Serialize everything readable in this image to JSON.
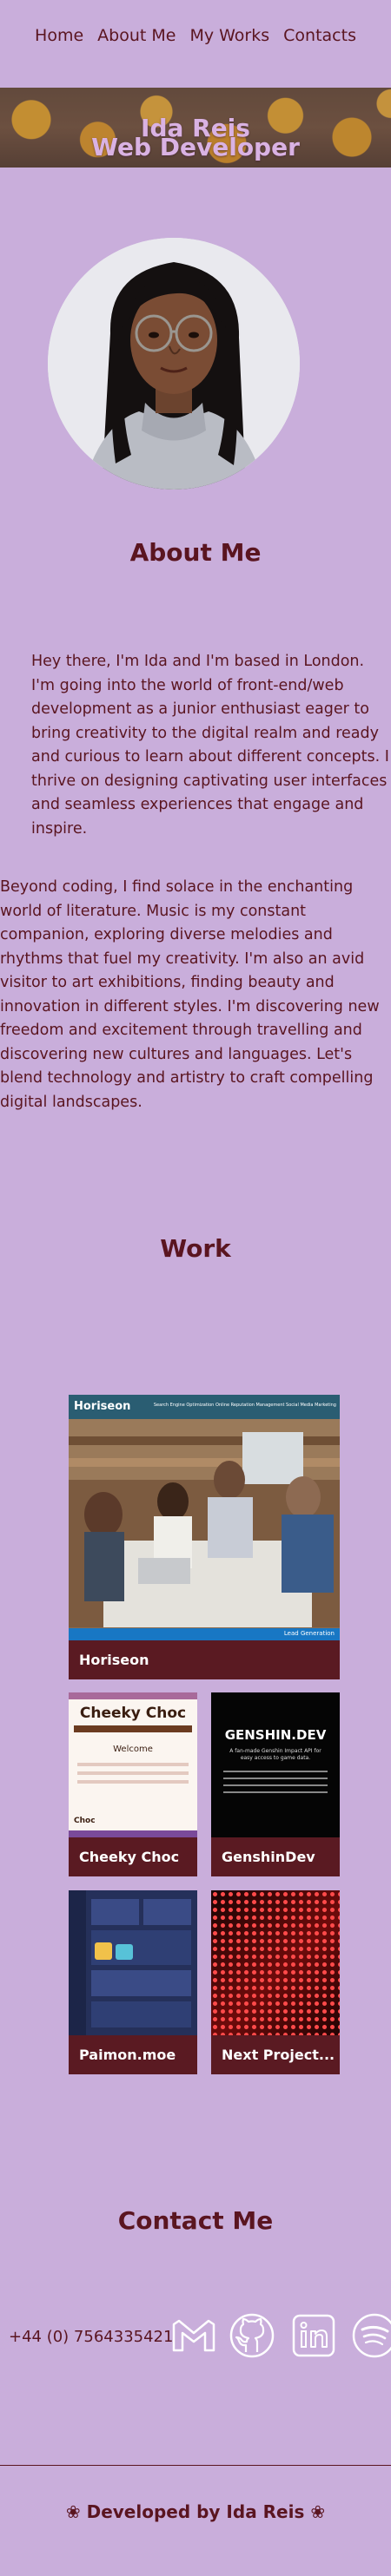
{
  "nav": {
    "items": [
      "Home",
      "About Me",
      "My Works",
      "Contacts"
    ]
  },
  "hero": {
    "name": "Ida Reis",
    "role": "Web Developer"
  },
  "about": {
    "title": "About Me",
    "paragraph1": "Hey there, I'm Ida and I'm based in London. I'm going into the world of front-end/web development as a junior enthusiast eager to bring creativity to the digital realm and ready and curious to learn about different concepts. I thrive on designing captivating user interfaces and seamless experiences that engage and inspire.",
    "paragraph2": "Beyond coding, I find solace in the enchanting world of literature. Music is my constant companion, exploring diverse melodies and rhythms that fuel my creativity. I'm also an avid visitor to art exhibitions, finding beauty and innovation in different styles. I'm discovering new freedom and excitement through travelling and discovering new cultures and languages. Let's blend technology and artistry to craft compelling digital landscapes."
  },
  "work": {
    "title": "Work",
    "projects": [
      {
        "name": "Horiseon",
        "preview_brand": "Horiseon",
        "preview_nav": "Search Engine Optimization   Online Reputation Management   Social Media Marketing",
        "preview_button": "Lead Generation"
      },
      {
        "name": "Cheeky Choc",
        "preview_brand": "Cheeky Choc",
        "preview_heading": "Welcome",
        "preview_footer": "Choc"
      },
      {
        "name": "GenshinDev",
        "preview_brand": "GENSHIN.DEV",
        "preview_tagline": "A fan-made Genshin Impact API for easy access to game data."
      },
      {
        "name": "Paimon.moe"
      },
      {
        "name": "Next Project..."
      }
    ]
  },
  "contact": {
    "title": "Contact Me",
    "phone": "+44 (0) 7564335421",
    "icons": [
      "gmail-icon",
      "github-icon",
      "linkedin-icon",
      "spotify-icon"
    ]
  },
  "footer": {
    "text": "❀ Developed by Ida Reis ❀"
  },
  "colors": {
    "background": "#c9aedb",
    "primary": "#5a1520",
    "card": "#5a1a22",
    "hero_text": "#d9b2e3"
  }
}
